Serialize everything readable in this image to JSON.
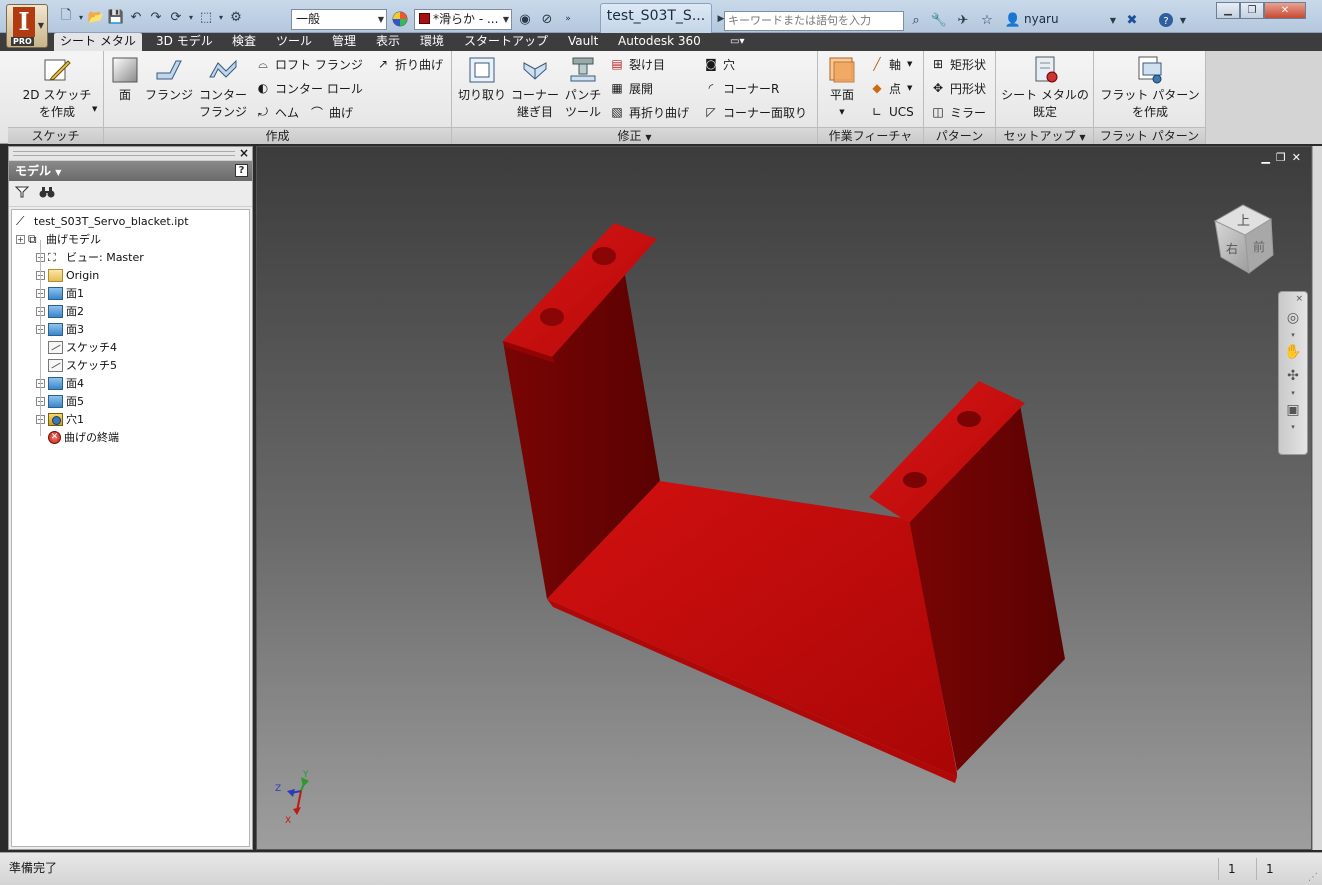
{
  "titlebar": {
    "doc_title": "test_S03T_S...",
    "style_combo": "一般",
    "visual_combo": "*滑らか - ...",
    "search_placeholder": "キーワードまたは語句を入力",
    "user": "nyaru",
    "pro_label": "PRO",
    "app_letter": "I"
  },
  "tabs": [
    {
      "label": "シート メタル",
      "active": true
    },
    {
      "label": "3D モデル"
    },
    {
      "label": "検査"
    },
    {
      "label": "ツール"
    },
    {
      "label": "管理"
    },
    {
      "label": "表示"
    },
    {
      "label": "環境"
    },
    {
      "label": "スタートアップ"
    },
    {
      "label": "Vault"
    },
    {
      "label": "Autodesk 360"
    }
  ],
  "ribbon": {
    "sketch": {
      "title": "スケッチ",
      "create_sketch": [
        "2D スケッチ",
        "を作成"
      ]
    },
    "create": {
      "title": "作成",
      "face": "面",
      "flange": "フランジ",
      "contour_flange": [
        "コンター",
        "フランジ"
      ],
      "loft_flange": "ロフト フランジ",
      "contour_roll": "コンター ロール",
      "hem": "ヘム",
      "bend": "曲げ",
      "fold": "折り曲げ"
    },
    "modify": {
      "title": "修正",
      "cut": "切り取り",
      "corner_seam": [
        "コーナー",
        "継ぎ目"
      ],
      "punch_tool": [
        "パンチ",
        "ツール"
      ],
      "rip": "裂け目",
      "unfold": "展開",
      "refold": "再折り曲げ",
      "hole": "穴",
      "corner_round": "コーナーR",
      "corner_chamfer": "コーナー面取り"
    },
    "work_features": {
      "title": "作業フィーチャ",
      "plane": "平面",
      "axis": "軸",
      "point": "点",
      "ucs": "UCS"
    },
    "pattern": {
      "title": "パターン",
      "rectangular": "矩形状",
      "circular": "円形状",
      "mirror": "ミラー"
    },
    "setup": {
      "title": "セットアップ",
      "sheet_metal_defaults": [
        "シート メタルの",
        "既定"
      ]
    },
    "flat_pattern": {
      "title": "フラット パターン",
      "create_flat": [
        "フラット パターン",
        "を作成"
      ]
    }
  },
  "browser": {
    "title": "モデル",
    "help": "?",
    "tree": [
      {
        "label": "test_S03T_Servo_blacket.ipt",
        "icon": "part-icon",
        "level": 0,
        "expander": false
      },
      {
        "label": "曲げモデル",
        "icon": "folded-model-icon",
        "level": 0,
        "expander": true
      },
      {
        "label": "ビュー: Master",
        "icon": "view-icon",
        "level": 1,
        "expander": true
      },
      {
        "label": "Origin",
        "icon": "folder-icon",
        "level": 1,
        "expander": true
      },
      {
        "label": "面1",
        "icon": "face-icon",
        "level": 1,
        "expander": true
      },
      {
        "label": "面2",
        "icon": "face-icon",
        "level": 1,
        "expander": true
      },
      {
        "label": "面3",
        "icon": "face-icon",
        "level": 1,
        "expander": true
      },
      {
        "label": "スケッチ4",
        "icon": "sketch-icon",
        "level": 1,
        "expander": false
      },
      {
        "label": "スケッチ5",
        "icon": "sketch-icon",
        "level": 1,
        "expander": false
      },
      {
        "label": "面4",
        "icon": "face-icon",
        "level": 1,
        "expander": true
      },
      {
        "label": "面5",
        "icon": "face-icon",
        "level": 1,
        "expander": true
      },
      {
        "label": "穴1",
        "icon": "hole-icon",
        "level": 1,
        "expander": true
      },
      {
        "label": "曲げの終端",
        "icon": "end-of-part-icon",
        "level": 1,
        "expander": false
      }
    ]
  },
  "viewcube": {
    "top": "上",
    "right": "右",
    "front": "前"
  },
  "triad": {
    "x": "X",
    "y": "Y",
    "z": "Z"
  },
  "status": {
    "text": "準備完了",
    "cell1": "1",
    "cell2": "1"
  },
  "colors": {
    "part": "#c40a0a",
    "part_dark": "#6e0303"
  }
}
